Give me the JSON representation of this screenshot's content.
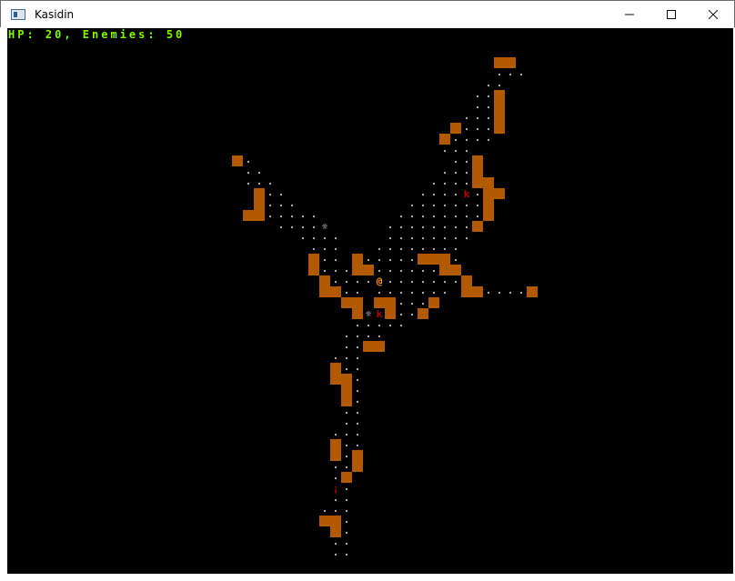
{
  "window": {
    "title": "Kasidin",
    "minimize_icon": "minimize-icon",
    "maximize_icon": "maximize-icon",
    "close_icon": "close-icon"
  },
  "hud": {
    "status_text": "HP: 20, Enemies: 50",
    "color": "#7cfc00"
  },
  "colors": {
    "wall": "#b35900",
    "floor": "#aaaaaa",
    "player": "#ff9900",
    "enemy": "#c00000",
    "item": "#ffffff",
    "background": "#000000"
  },
  "map": {
    "tile_legend": {
      "wall": "#",
      "floor": ".",
      "player": "@",
      "enemy": "k",
      "item": "*",
      "potion": "!"
    },
    "player_glyph": "@",
    "enemy_glyph": "k",
    "item_glyph": "☼",
    "potion_glyph": "¡",
    "grid": [
      "                                                                   ",
      "                                                                   ",
      "                                            ##                     ",
      "                                            ...                    ",
      "                                           ..                      ",
      "                                          ..#                      ",
      "                                          ..#                      ",
      "                                         ...#                      ",
      "                                        #...#                      ",
      "                                       #....                       ",
      "                                       ...                         ",
      "                    #.                  ..#                        ",
      "                     ..                ...#                        ",
      "                     ...              ....##                       ",
      "                      #..            ....k.##                      ",
      "                      #...          .......#                       ",
      "                     ##.....       ........#                       ",
      "                        ....*     ........#                        ",
      "                          ....    ........                         ",
      "                           ...   ........                          ",
      "                           #.. #.....###.                          ",
      "                           #...##......##                          ",
      "                            #....@.......#                         ",
      "                            ##.. ....... ##....#                   ",
      "                              ## ##...#                            ",
      "                               #*k#..#                             ",
      "                               .....                               ",
      "                              ....                                 ",
      "                              ..##                                 ",
      "                             ...                                   ",
      "                             #..                                   ",
      "                             ##.                                   ",
      "                              #.                                   ",
      "                              #.                                   ",
      "                              ..                                   ",
      "                              ..                                   ",
      "                             ...                                   ",
      "                             #..                                   ",
      "                             #.#                                   ",
      "                             ..#                                   ",
      "                             .#                                    ",
      "                             !.                                    ",
      "                             ..                                    ",
      "                            ...                                    ",
      "                            ##.                                    ",
      "                             #.                                    ",
      "                             ..                                    ",
      "                             ..                                    "
    ]
  }
}
